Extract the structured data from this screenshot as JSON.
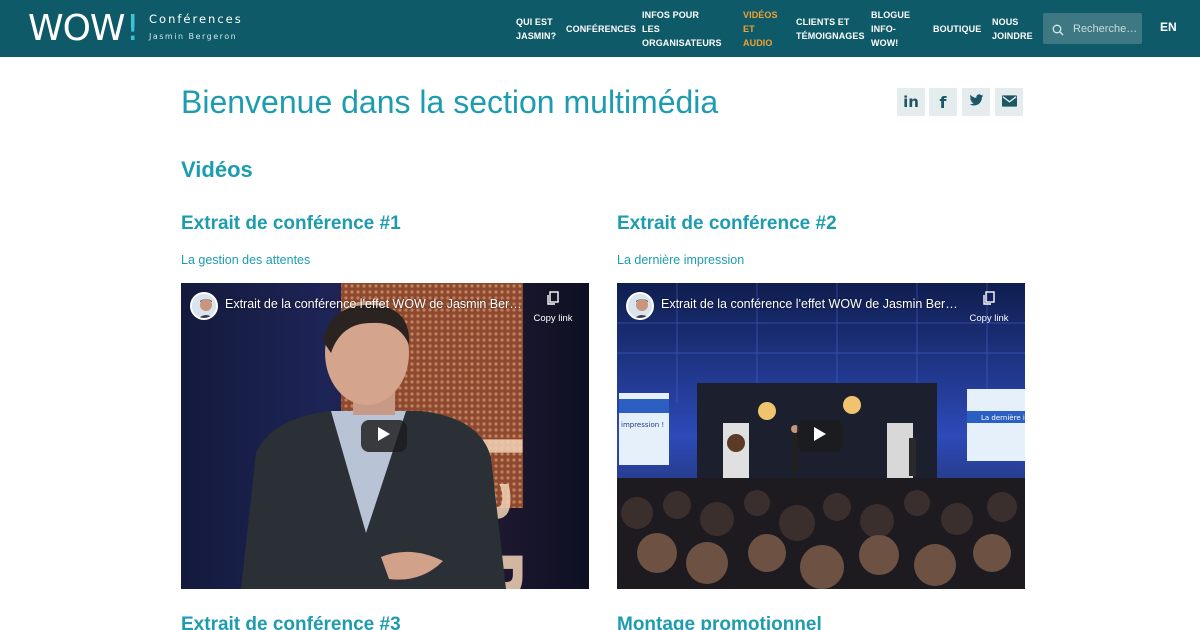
{
  "header": {
    "logo": {
      "wow": "WOW",
      "excl": "!",
      "line1": "Conférences",
      "line2": "Jasmin Bergeron"
    },
    "nav": [
      {
        "label": "QUI EST\nJASMIN?",
        "active": false
      },
      {
        "label": "CONFÉRENCES",
        "active": false
      },
      {
        "label": "INFOS POUR\nLES ORGANISATEURS",
        "active": false
      },
      {
        "label": "VIDÉOS\nET AUDIO",
        "active": true
      },
      {
        "label": "CLIENTS ET\nTÉMOIGNAGES",
        "active": false
      },
      {
        "label": "BLOGUE\nINFO-WOW!",
        "active": false
      },
      {
        "label": "BOUTIQUE",
        "active": false
      },
      {
        "label": "NOUS\nJOINDRE",
        "active": false
      }
    ],
    "search": {
      "placeholder": "Recherche…"
    },
    "lang": "EN"
  },
  "page": {
    "title": "Bienvenue dans la section multimédia",
    "share_icons": [
      "linkedin-icon",
      "facebook-icon",
      "twitter-icon",
      "email-icon"
    ],
    "section_title": "Vidéos"
  },
  "videos": [
    {
      "title": "Extrait de conférence #1",
      "subtitle": "La gestion des attentes",
      "player_title": "Extrait de la conférence l'effet WOW de Jasmin Berg…",
      "copy_link": "Copy link"
    },
    {
      "title": "Extrait de conférence #2",
      "subtitle": "La dernière impression",
      "player_title": "Extrait de la conférence l'effet WOW de Jasmin Berg…",
      "copy_link": "Copy link"
    }
  ],
  "bottom": [
    {
      "title": "Extrait de conférence #3"
    },
    {
      "title": "Montage promotionnel"
    }
  ],
  "colors": {
    "header": "#0f5a68",
    "accent": "#1d9cb0",
    "active_nav": "#f0a233"
  }
}
